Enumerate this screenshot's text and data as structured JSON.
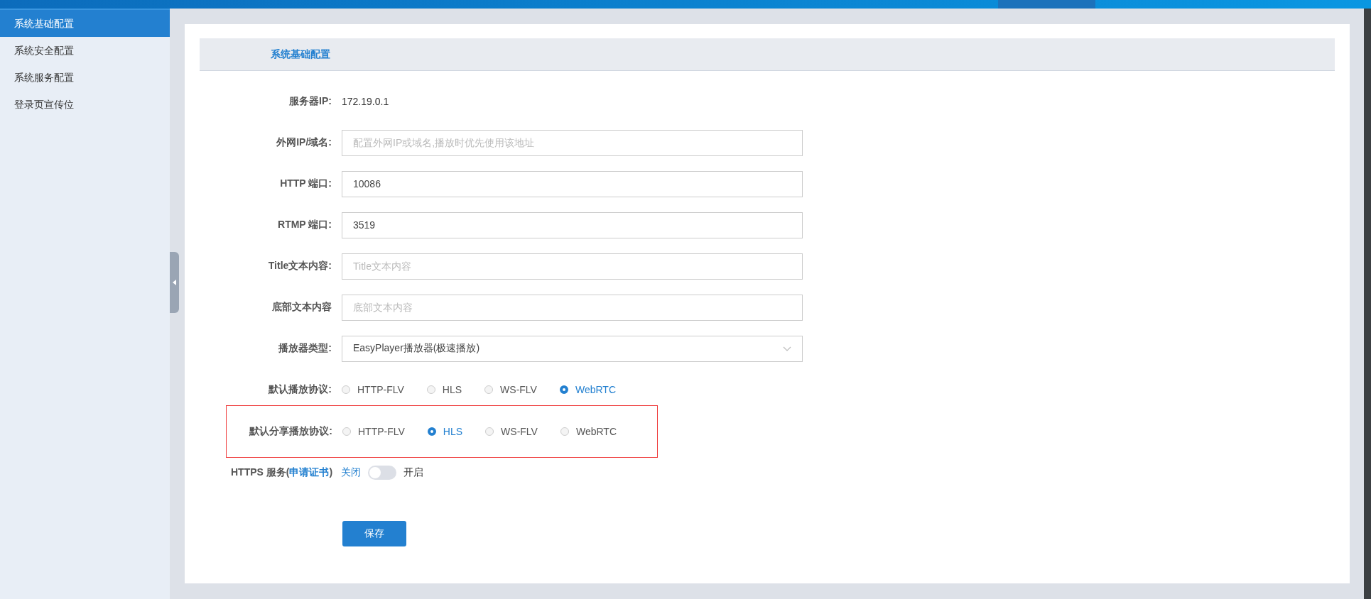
{
  "sidebar": {
    "items": [
      {
        "label": "系统基础配置",
        "selected": true
      },
      {
        "label": "系统安全配置",
        "selected": false
      },
      {
        "label": "系统服务配置",
        "selected": false
      },
      {
        "label": "登录页宣传位",
        "selected": false
      }
    ]
  },
  "form": {
    "title": "系统基础配置",
    "fields": [
      {
        "kind": "text",
        "label": "服务器IP:",
        "value": "172.19.0.1"
      },
      {
        "kind": "input",
        "label": "外网IP/域名:",
        "placeholder": "配置外网IP或域名,播放时优先使用该地址"
      },
      {
        "kind": "input",
        "label": "HTTP 端口:",
        "value": "10086"
      },
      {
        "kind": "input",
        "label": "RTMP 端口:",
        "value": "3519"
      },
      {
        "kind": "input",
        "label": "Title文本内容:",
        "placeholder": "Title文本内容"
      },
      {
        "kind": "input",
        "label": "底部文本内容",
        "placeholder": "底部文本内容"
      },
      {
        "kind": "select",
        "label": "播放器类型:",
        "value": "EasyPlayer播放器(极速播放)"
      },
      {
        "kind": "radio",
        "label": "默认播放协议:",
        "highlighted": false,
        "options": [
          {
            "label": "HTTP-FLV",
            "selected": false
          },
          {
            "label": "HLS",
            "selected": false
          },
          {
            "label": "WS-FLV",
            "selected": false
          },
          {
            "label": "WebRTC",
            "selected": true
          }
        ]
      },
      {
        "kind": "radio",
        "label": "默认分享播放协议:",
        "highlighted": true,
        "options": [
          {
            "label": "HTTP-FLV",
            "selected": false
          },
          {
            "label": "HLS",
            "selected": true
          },
          {
            "label": "WS-FLV",
            "selected": false
          },
          {
            "label": "WebRTC",
            "selected": false
          }
        ]
      },
      {
        "kind": "switch",
        "label": "HTTPS 服务(",
        "link": "申请证书",
        "label_end": ")",
        "off_label": "关闭",
        "on_label": "开启",
        "on": false
      }
    ],
    "save_button": "保存"
  }
}
